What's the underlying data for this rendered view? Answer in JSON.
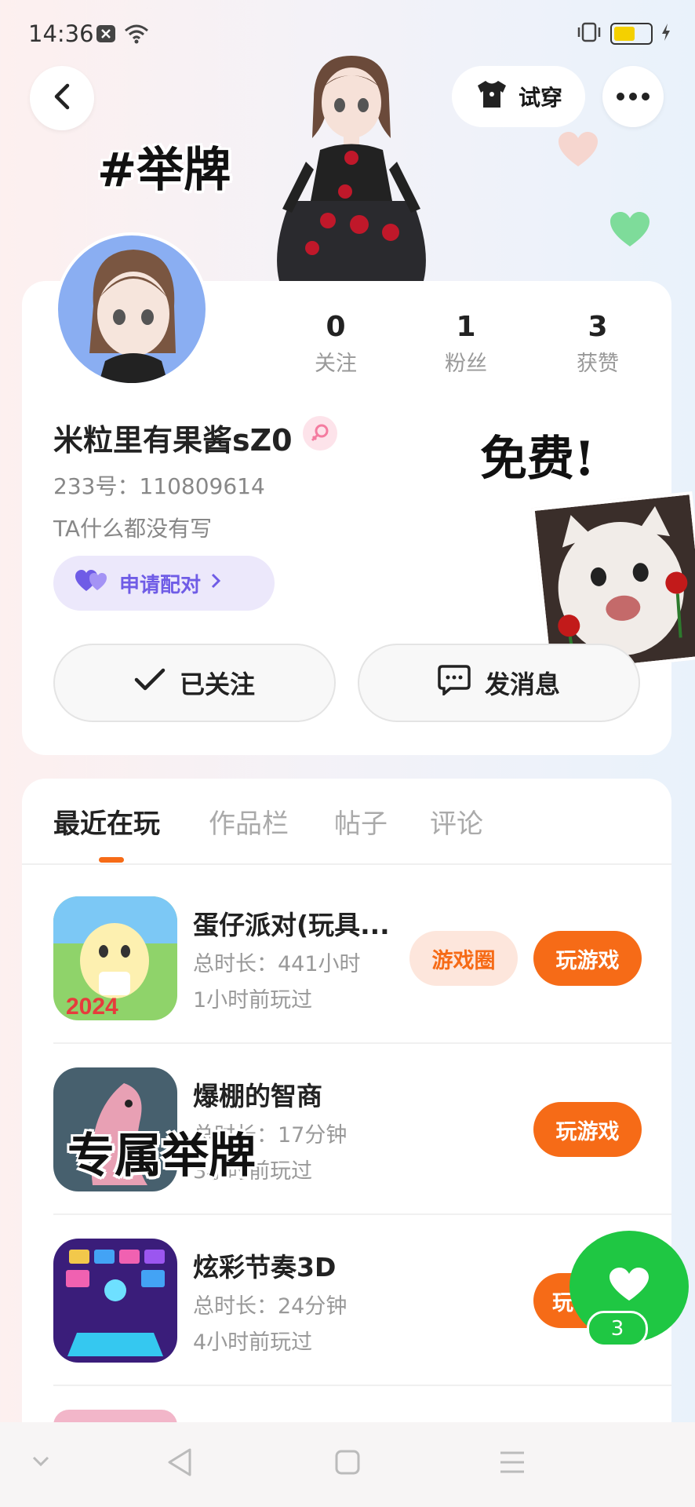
{
  "status_bar": {
    "time": "14:36"
  },
  "header": {
    "try_on_label": "试穿"
  },
  "stickers": {
    "hashtag": "#举牌",
    "free": "免费!",
    "exclusive": "专属举牌"
  },
  "profile": {
    "stats": [
      {
        "value": "0",
        "label": "关注"
      },
      {
        "value": "1",
        "label": "粉丝"
      },
      {
        "value": "3",
        "label": "获赞"
      }
    ],
    "nickname": "米粒里有果酱sZ0",
    "id_text": "233号：110809614",
    "bio": "TA什么都没有写",
    "pair_label": "申请配对",
    "follow_label": "已关注",
    "message_label": "发消息"
  },
  "tabs": [
    "最近在玩",
    "作品栏",
    "帖子",
    "评论"
  ],
  "games": [
    {
      "title": "蛋仔派对(玩具...",
      "duration": "总时长：441小时",
      "last_played": "1小时前玩过",
      "circle_label": "游戏圈",
      "play_label": "玩游戏"
    },
    {
      "title": "爆棚的智商",
      "duration": "总时长：17分钟",
      "last_played": "3小时前玩过",
      "play_label": "玩游戏"
    },
    {
      "title": "炫彩节奏3D",
      "duration": "总时长：24分钟",
      "last_played": "4小时前玩过",
      "play_label": "玩"
    }
  ],
  "like_fab": {
    "count": "3"
  },
  "colors": {
    "accent_orange": "#f66b17",
    "pair_purple": "#6f5ce6",
    "like_green": "#1fc743"
  }
}
